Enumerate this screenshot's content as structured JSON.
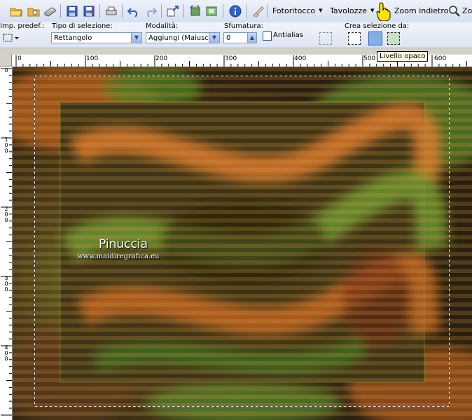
{
  "toolbar": {
    "menus": {
      "fotoritocco": "Fotoritocco",
      "tavolozze": "Tavolozze",
      "zoom_indietro": "Zoom indietro",
      "zoom_partial": "Zo"
    }
  },
  "options": {
    "preset_label": "Imp. predef.:",
    "selection_type_label": "Tipo di selezione:",
    "selection_type_value": "Rettangolo",
    "mode_label": "Modalità:",
    "mode_value": "Aggiungi (Maiusc)",
    "feather_label": "Sfumatura:",
    "feather_value": "0",
    "antialias_label": "Antialias",
    "create_from_label": "Crea selezione da:"
  },
  "tooltip": "Livello opaco",
  "rulers": {
    "horizontal": [
      "0",
      "100",
      "200",
      "300",
      "400",
      "500",
      "600"
    ],
    "vertical": [
      "0",
      "100",
      "200",
      "300",
      "400"
    ]
  },
  "watermark": {
    "name": "Pinuccia",
    "url": "www.maidiregrafica.eu"
  },
  "colors": {
    "canvas_orange": "#c8661e",
    "canvas_green": "#5a8a26",
    "canvas_dark": "#3a2a12"
  }
}
